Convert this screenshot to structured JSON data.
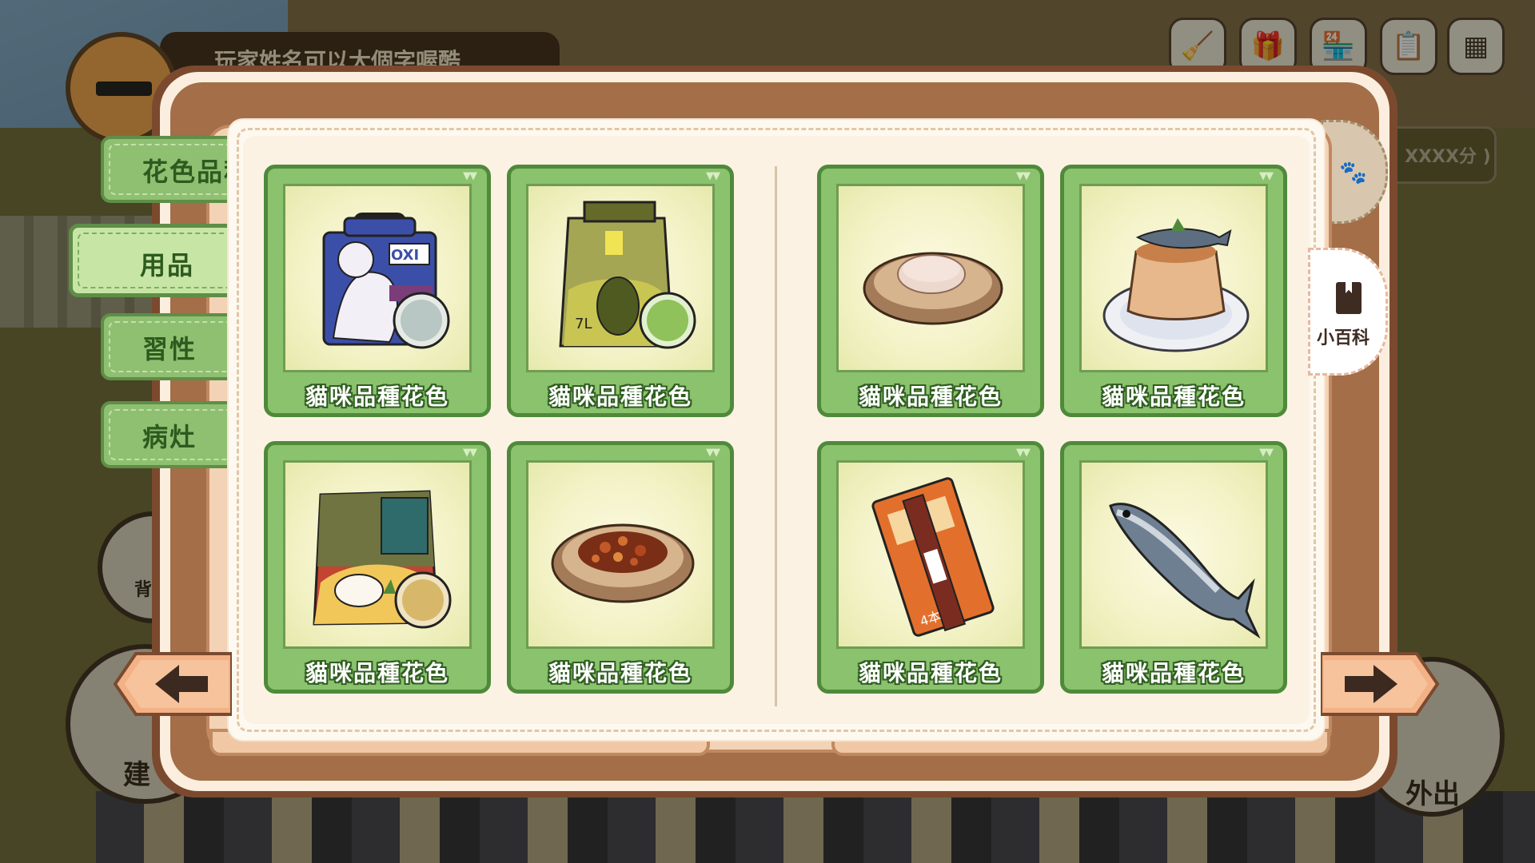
{
  "player": {
    "name_text": "玩家姓名可以大個字喔酷"
  },
  "top_icons": [
    "broom-icon",
    "gift-icon",
    "shop-icon",
    "clipboard-icon",
    "menu-grid-icon"
  ],
  "score": {
    "text": "( XXXX分 )"
  },
  "side_buttons": {
    "bag_label": "背",
    "build_label": "建",
    "out_label": "外出"
  },
  "tabs": [
    {
      "label": "花色品種"
    },
    {
      "label": "用品"
    },
    {
      "label": "習性"
    },
    {
      "label": "病灶"
    }
  ],
  "active_tab": "用品",
  "cards": [
    {
      "label": "貓咪品種花色",
      "item": "cat-litter-box-icon"
    },
    {
      "label": "貓咪品種花色",
      "item": "cat-litter-bag-icon"
    },
    {
      "label": "貓咪品種花色",
      "item": "canned-food-dish-icon"
    },
    {
      "label": "貓咪品種花色",
      "item": "fish-pudding-plate-icon"
    },
    {
      "label": "貓咪品種花色",
      "item": "tofu-litter-bag-icon"
    },
    {
      "label": "貓咪品種花色",
      "item": "dry-food-bowl-icon"
    },
    {
      "label": "貓咪品種花色",
      "item": "cat-treat-pouch-icon"
    },
    {
      "label": "貓咪品種花色",
      "item": "fish-icon"
    }
  ],
  "encyclopedia": {
    "label": "小百科"
  },
  "pouch_text": "4本",
  "colors": {
    "card_green": "#8bc26d",
    "card_border": "#4f8a3a",
    "book_brown": "#7b4a2e",
    "tab_green": "#8fc072"
  }
}
